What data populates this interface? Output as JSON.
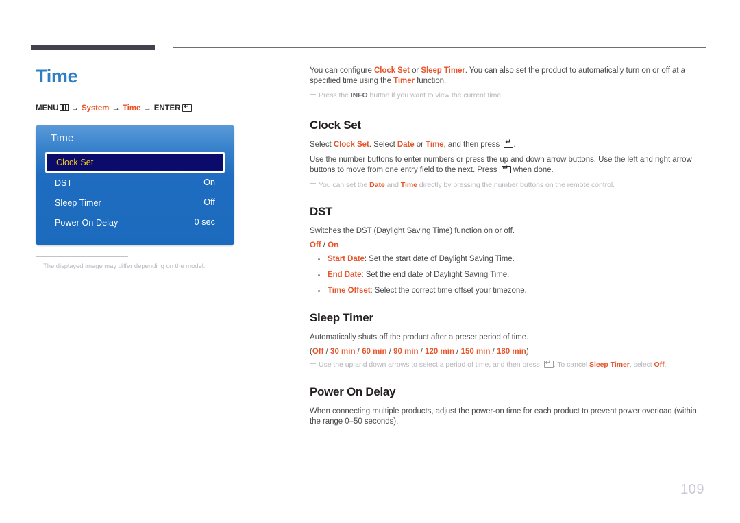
{
  "page": {
    "title": "Time",
    "number": "109"
  },
  "breadcrumb": {
    "menu_label": "MENU",
    "menu_icon": "menu-grid-icon",
    "arrow": "→",
    "step_system": "System",
    "step_time": "Time",
    "enter_label": "ENTER",
    "enter_icon": "enter-key-icon"
  },
  "osd": {
    "title": "Time",
    "rows": [
      {
        "label": "Clock Set",
        "value": "",
        "selected": true
      },
      {
        "label": "DST",
        "value": "On",
        "selected": false
      },
      {
        "label": "Sleep Timer",
        "value": "Off",
        "selected": false
      },
      {
        "label": "Power On Delay",
        "value": "0 sec",
        "selected": false
      }
    ]
  },
  "left_note": "The displayed image may differ depending on the model.",
  "intro": {
    "p1_a": "You can configure ",
    "p1_b1": "Clock Set",
    "p1_c": " or ",
    "p1_b2": "Sleep Timer",
    "p1_d": ". You can also set the product to automatically turn on or off at a specified time using the ",
    "p1_b3": "Timer",
    "p1_e": " function.",
    "note_a": "Press the ",
    "note_b": "INFO",
    "note_c": " button if you want to view the current time."
  },
  "clock_set": {
    "heading": "Clock Set",
    "p1_a": "Select ",
    "p1_b1": "Clock Set",
    "p1_c": ". Select ",
    "p1_b2": "Date",
    "p1_d": " or ",
    "p1_b3": "Time",
    "p1_e": ", and then press ",
    "p1_f": ".",
    "p2_a": "Use the number buttons to enter numbers or press the up and down arrow buttons. Use the left and right arrow buttons to move from one entry field to the next. Press ",
    "p2_b": " when done.",
    "note_a": "You can set the ",
    "note_b1": "Date",
    "note_c": " and ",
    "note_b2": "Time",
    "note_d": " directly by pressing the number buttons on the remote control."
  },
  "dst": {
    "heading": "DST",
    "p1": "Switches the DST (Daylight Saving Time) function on or off.",
    "options_off": "Off",
    "options_sep": " / ",
    "options_on": "On",
    "bullets": [
      {
        "term": "Start Date",
        "desc": ": Set the start date of Daylight Saving Time."
      },
      {
        "term": "End Date",
        "desc": ": Set the end date of Daylight Saving Time."
      },
      {
        "term": "Time Offset",
        "desc": ": Select the correct time offset your timezone."
      }
    ]
  },
  "sleep_timer": {
    "heading": "Sleep Timer",
    "p1": "Automatically shuts off the product after a preset period of time.",
    "options_open": "(",
    "options": [
      "Off",
      "30 min",
      "60 min",
      "90 min",
      "120 min",
      "150 min",
      "180 min"
    ],
    "options_sep": " / ",
    "options_close": ")",
    "note_a": "Use the up and down arrows to select a period of time, and then press ",
    "note_b": ". To cancel ",
    "note_c": "Sleep Timer",
    "note_d": ", select ",
    "note_e": "Off",
    "note_f": "."
  },
  "power_on_delay": {
    "heading": "Power On Delay",
    "p1": "When connecting multiple products, adjust the power-on time for each product to prevent power overload (within the range 0–50 seconds)."
  }
}
